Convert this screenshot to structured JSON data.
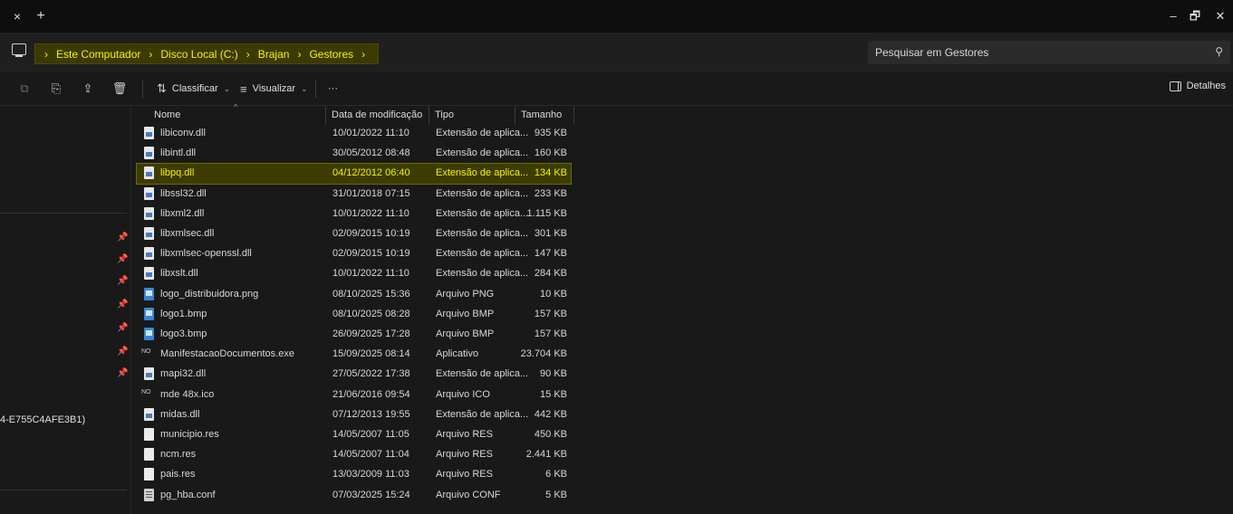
{
  "window": {
    "tab_close": "×",
    "tab_new": "+",
    "minimize": "–",
    "maximize": "🗗",
    "close": "✕"
  },
  "breadcrumb": [
    "Este Computador",
    "Disco Local (C:)",
    "Brajan",
    "Gestores"
  ],
  "search": {
    "placeholder": "Pesquisar em Gestores",
    "icon": "search-icon"
  },
  "toolbar": {
    "sort_label": "Classificar",
    "view_label": "Visualizar",
    "more_label": "···",
    "details_label": "Detalhes"
  },
  "columns": {
    "name": "Nome",
    "date": "Data de modificação",
    "type": "Tipo",
    "size": "Tamanho"
  },
  "nav": {
    "truncated_item": "4-E755C4AFE3B1)"
  },
  "files": [
    {
      "name": "libiconv.dll",
      "date": "10/01/2022 11:10",
      "type": "Extensão de aplica...",
      "size": "935 KB",
      "icon": "dll"
    },
    {
      "name": "libintl.dll",
      "date": "30/05/2012 08:48",
      "type": "Extensão de aplica...",
      "size": "160 KB",
      "icon": "dll"
    },
    {
      "name": "libpq.dll",
      "date": "04/12/2012 06:40",
      "type": "Extensão de aplica...",
      "size": "134 KB",
      "icon": "dll",
      "selected": true
    },
    {
      "name": "libssl32.dll",
      "date": "31/01/2018 07:15",
      "type": "Extensão de aplica...",
      "size": "233 KB",
      "icon": "dll"
    },
    {
      "name": "libxml2.dll",
      "date": "10/01/2022 11:10",
      "type": "Extensão de aplica...",
      "size": "1.115 KB",
      "icon": "dll"
    },
    {
      "name": "libxmlsec.dll",
      "date": "02/09/2015 10:19",
      "type": "Extensão de aplica...",
      "size": "301 KB",
      "icon": "dll"
    },
    {
      "name": "libxmlsec-openssl.dll",
      "date": "02/09/2015 10:19",
      "type": "Extensão de aplica...",
      "size": "147 KB",
      "icon": "dll"
    },
    {
      "name": "libxslt.dll",
      "date": "10/01/2022 11:10",
      "type": "Extensão de aplica...",
      "size": "284 KB",
      "icon": "dll"
    },
    {
      "name": "logo_distribuidora.png",
      "date": "08/10/2025 15:36",
      "type": "Arquivo PNG",
      "size": "10 KB",
      "icon": "img"
    },
    {
      "name": "logo1.bmp",
      "date": "08/10/2025 08:28",
      "type": "Arquivo BMP",
      "size": "157 KB",
      "icon": "img"
    },
    {
      "name": "logo3.bmp",
      "date": "26/09/2025 17:28",
      "type": "Arquivo BMP",
      "size": "157 KB",
      "icon": "img"
    },
    {
      "name": "ManifestacaoDocumentos.exe",
      "date": "15/09/2025 08:14",
      "type": "Aplicativo",
      "size": "23.704 KB",
      "icon": "exe"
    },
    {
      "name": "mapi32.dll",
      "date": "27/05/2022 17:38",
      "type": "Extensão de aplica...",
      "size": "90 KB",
      "icon": "dll"
    },
    {
      "name": "mde 48x.ico",
      "date": "21/06/2016 09:54",
      "type": "Arquivo ICO",
      "size": "15 KB",
      "icon": "exe"
    },
    {
      "name": "midas.dll",
      "date": "07/12/2013 19:55",
      "type": "Extensão de aplica...",
      "size": "442 KB",
      "icon": "dll"
    },
    {
      "name": "municipio.res",
      "date": "14/05/2007 11:05",
      "type": "Arquivo RES",
      "size": "450 KB",
      "icon": "file"
    },
    {
      "name": "ncm.res",
      "date": "14/05/2007 11:04",
      "type": "Arquivo RES",
      "size": "2.441 KB",
      "icon": "file"
    },
    {
      "name": "pais.res",
      "date": "13/03/2009 11:03",
      "type": "Arquivo RES",
      "size": "6 KB",
      "icon": "file"
    },
    {
      "name": "pg_hba.conf",
      "date": "07/03/2025 15:24",
      "type": "Arquivo CONF",
      "size": "5 KB",
      "icon": "conf"
    }
  ]
}
